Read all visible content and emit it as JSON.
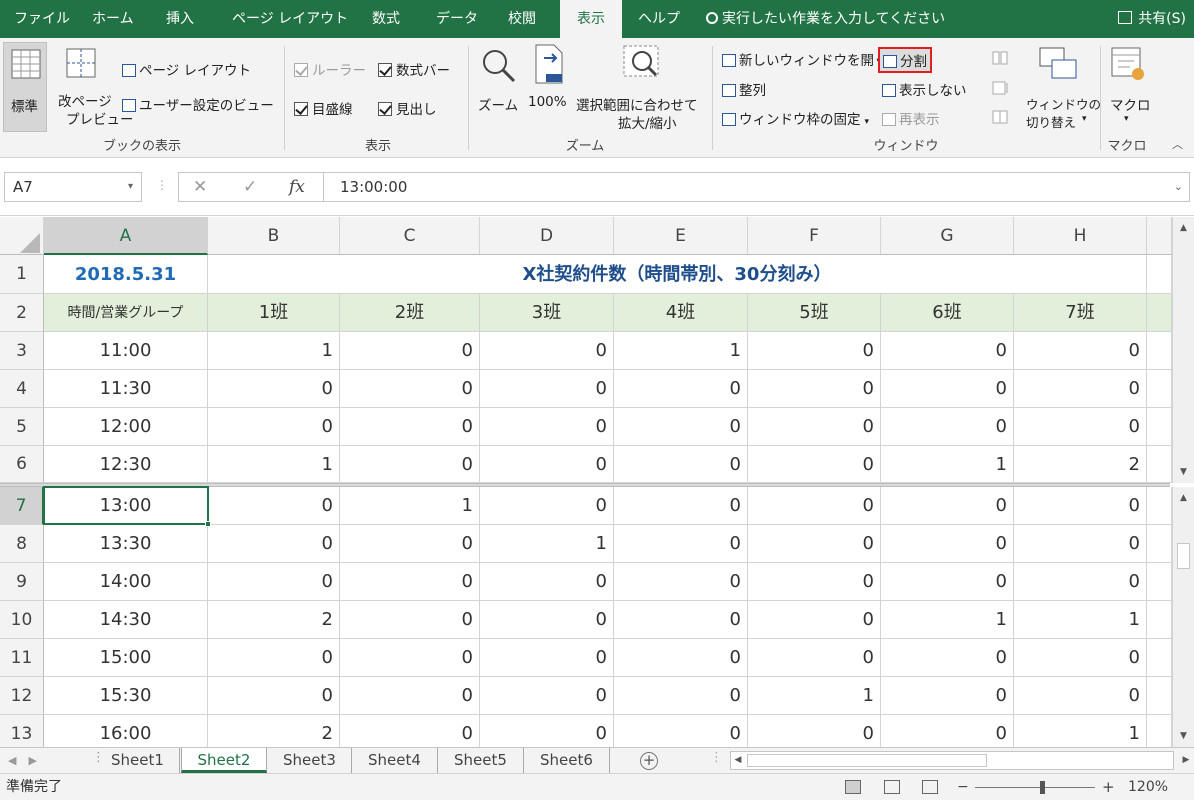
{
  "tabs": [
    "ファイル",
    "ホーム",
    "挿入",
    "ページ レイアウト",
    "数式",
    "データ",
    "校閲",
    "表示",
    "ヘルプ"
  ],
  "active_tab": "表示",
  "tell_me": "実行したい作業を入力してください",
  "share": "共有(S)",
  "ribbon": {
    "workbook_views": {
      "normal": "標準",
      "page_break_line1": "改ページ",
      "page_break_line2": "プレビュー",
      "page_layout": "ページ レイアウト",
      "custom_views": "ユーザー設定のビュー",
      "label": "ブックの表示"
    },
    "show": {
      "ruler": "ルーラー",
      "formula_bar": "数式バー",
      "gridlines": "目盛線",
      "headings": "見出し",
      "label": "表示"
    },
    "zoom": {
      "zoom": "ズーム",
      "hundred": "100%",
      "selection_line1": "選択範囲に合わせて",
      "selection_line2": "拡大/縮小",
      "label": "ズーム"
    },
    "window": {
      "new_window": "新しいウィンドウを開く",
      "arrange": "整列",
      "freeze": "ウィンドウ枠の固定",
      "split": "分割",
      "hide": "表示しない",
      "unhide": "再表示",
      "switch_line1": "ウィンドウの",
      "switch_line2": "切り替え",
      "label": "ウィンドウ"
    },
    "macros": {
      "macro": "マクロ",
      "label": "マクロ"
    }
  },
  "formula_bar": {
    "name_box": "A7",
    "formula": "13:00:00"
  },
  "columns": [
    "A",
    "B",
    "C",
    "D",
    "E",
    "F",
    "G",
    "H"
  ],
  "sheet": {
    "date": "2018.5.31",
    "title": "X社契約件数（時間帯別、30分刻み）",
    "header_a": "時間/営業グループ",
    "groups": [
      "1班",
      "2班",
      "3班",
      "4班",
      "5班",
      "6班",
      "7班"
    ],
    "rows": [
      {
        "n": "3",
        "time": "11:00",
        "v": [
          "1",
          "0",
          "0",
          "1",
          "0",
          "0",
          "0"
        ]
      },
      {
        "n": "4",
        "time": "11:30",
        "v": [
          "0",
          "0",
          "0",
          "0",
          "0",
          "0",
          "0"
        ]
      },
      {
        "n": "5",
        "time": "12:00",
        "v": [
          "0",
          "0",
          "0",
          "0",
          "0",
          "0",
          "0"
        ]
      },
      {
        "n": "6",
        "time": "12:30",
        "v": [
          "1",
          "0",
          "0",
          "0",
          "0",
          "1",
          "2"
        ]
      },
      {
        "n": "7",
        "time": "13:00",
        "v": [
          "0",
          "1",
          "0",
          "0",
          "0",
          "0",
          "0"
        ]
      },
      {
        "n": "8",
        "time": "13:30",
        "v": [
          "0",
          "0",
          "1",
          "0",
          "0",
          "0",
          "0"
        ]
      },
      {
        "n": "9",
        "time": "14:00",
        "v": [
          "0",
          "0",
          "0",
          "0",
          "0",
          "0",
          "0"
        ]
      },
      {
        "n": "10",
        "time": "14:30",
        "v": [
          "2",
          "0",
          "0",
          "0",
          "0",
          "1",
          "1"
        ]
      },
      {
        "n": "11",
        "time": "15:00",
        "v": [
          "0",
          "0",
          "0",
          "0",
          "0",
          "0",
          "0"
        ]
      },
      {
        "n": "12",
        "time": "15:30",
        "v": [
          "0",
          "0",
          "0",
          "0",
          "1",
          "0",
          "0"
        ]
      },
      {
        "n": "13",
        "time": "16:00",
        "v": [
          "2",
          "0",
          "0",
          "0",
          "0",
          "0",
          "1"
        ]
      }
    ]
  },
  "sheet_tabs": [
    "Sheet1",
    "Sheet2",
    "Sheet3",
    "Sheet4",
    "Sheet5",
    "Sheet6"
  ],
  "active_sheet": "Sheet2",
  "status": "準備完了",
  "zoom_level": "120%",
  "colors": {
    "accent": "#217346",
    "highlight": "#e01e1e",
    "header_fill": "#e2efda",
    "date_color": "#1f6bb5"
  }
}
